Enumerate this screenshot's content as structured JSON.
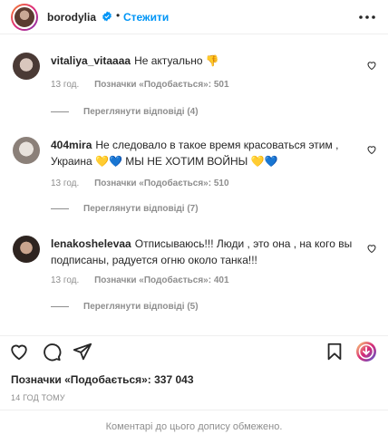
{
  "header": {
    "username": "borodylia",
    "separator": "•",
    "follow_label": "Стежити"
  },
  "comments": [
    {
      "username": "vitaliya_vitaaaa",
      "text": "Не актуально 👎",
      "time": "13 год.",
      "likes": "Позначки «Подобається»: 501",
      "replies": "Переглянути відповіді (4)"
    },
    {
      "username": "404mira",
      "text": "Не следовало в такое время красоваться этим , Украина 💛💙 МЫ НЕ ХОТИМ ВОЙНЫ 💛💙",
      "time": "13 год.",
      "likes": "Позначки «Подобається»: 510",
      "replies": "Переглянути відповіді (7)"
    },
    {
      "username": "lenakoshelevaa",
      "text": "Отписываюсь!!! Люди , это она , на кого вы подписаны, радуется огню около танка!!!",
      "time": "13 год.",
      "likes": "Позначки «Подобається»: 401",
      "replies": "Переглянути відповіді (5)"
    }
  ],
  "post": {
    "likes_total": "Позначки «Подобається»: 337 043",
    "time_ago": "14 ГОД ТОМУ",
    "comments_closed": "Коментарі до цього допису обмежено."
  },
  "colors": {
    "accent": "#0095f6",
    "muted": "#8e8e8e",
    "text": "#262626"
  }
}
